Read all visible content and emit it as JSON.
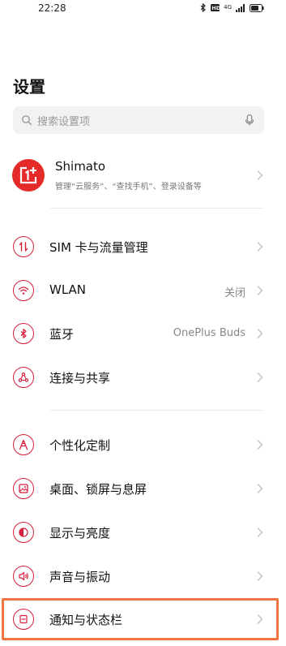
{
  "status_bar": {
    "time": "22:28",
    "network_label": "4G"
  },
  "page": {
    "title": "设置"
  },
  "search": {
    "placeholder": "搜索设置项"
  },
  "account": {
    "name": "Shimato",
    "subtitle": "管理“云服务”、“查找手机”、登录设备等"
  },
  "groups": [
    {
      "items": [
        {
          "label": "SIM 卡与流量管理",
          "value": "",
          "icon": "sim-icon"
        },
        {
          "label": "WLAN",
          "value": "关闭",
          "icon": "wifi-icon"
        },
        {
          "label": "蓝牙",
          "value": "OnePlus Buds",
          "icon": "bluetooth-icon"
        },
        {
          "label": "连接与共享",
          "value": "",
          "icon": "share-icon"
        }
      ]
    },
    {
      "items": [
        {
          "label": "个性化定制",
          "value": "",
          "icon": "personalize-icon"
        },
        {
          "label": "桌面、锁屏与息屏",
          "value": "",
          "icon": "wallpaper-icon"
        },
        {
          "label": "显示与亮度",
          "value": "",
          "icon": "brightness-icon"
        },
        {
          "label": "声音与振动",
          "value": "",
          "icon": "sound-icon"
        },
        {
          "label": "通知与状态栏",
          "value": "",
          "icon": "notification-icon"
        }
      ]
    }
  ],
  "colors": {
    "accent": "#d6203e",
    "avatar_bg": "#e52a2a",
    "highlight": "#f0743f"
  }
}
